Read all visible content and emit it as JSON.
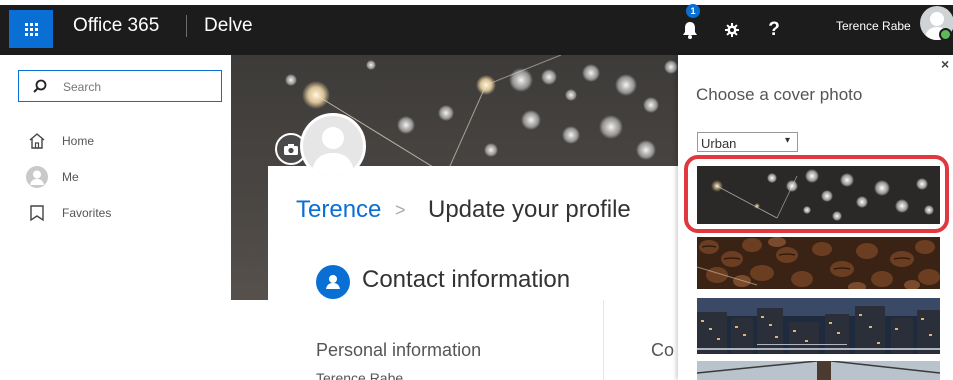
{
  "topbar": {
    "brand": "Office 365",
    "app": "Delve",
    "notification_count": "1",
    "help_label": "?",
    "user_name": "Terence Rabe"
  },
  "left_nav": {
    "search_placeholder": "Search",
    "items": [
      {
        "label": "Home",
        "icon": "home-icon"
      },
      {
        "label": "Me",
        "icon": "person-icon"
      },
      {
        "label": "Favorites",
        "icon": "bookmark-icon"
      }
    ]
  },
  "profile": {
    "name": "Terence",
    "separator": ">",
    "page_title": "Update your profile",
    "section_title": "Contact information",
    "personal_info_label": "Personal information",
    "personal_info_value": "Terence Rabe",
    "second_column_label": "Co"
  },
  "cover_panel": {
    "title": "Choose a cover photo",
    "close_label": "×",
    "category_selected": "Urban",
    "dropdown_arrow": "▾",
    "thumbnails": [
      {
        "name": "bokeh-lights",
        "selected": true
      },
      {
        "name": "coffee-beans",
        "selected": false
      },
      {
        "name": "city-night",
        "selected": false
      },
      {
        "name": "bridge",
        "selected": false
      }
    ]
  },
  "colors": {
    "accent": "#0a6fd4",
    "topbar": "#1c1c1c",
    "highlight": "#e0383e"
  }
}
